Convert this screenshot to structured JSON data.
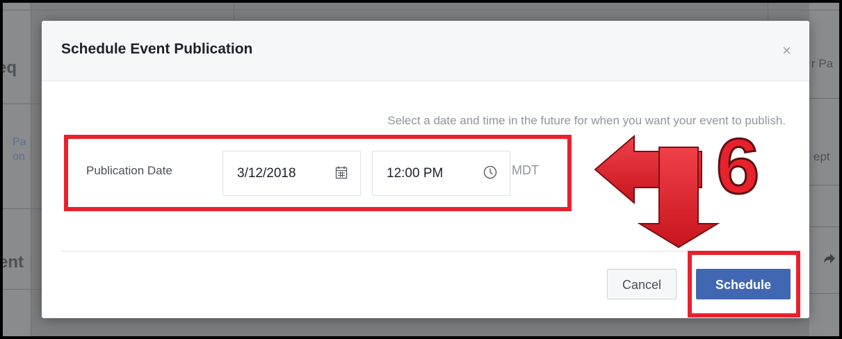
{
  "background": {
    "fragments": [
      "eq",
      "r Pa",
      "Pa",
      "on",
      "ept",
      "ent"
    ]
  },
  "dialog": {
    "title": "Schedule Event Publication",
    "close_glyph": "×",
    "hint": "Select a date and time in the future for when you want your event to publish.",
    "publication_label": "Publication Date",
    "date_value": "3/12/2018",
    "time_value": "12:00 PM",
    "timezone": "MDT",
    "cancel_label": "Cancel",
    "schedule_label": "Schedule"
  },
  "annotation": {
    "step_number": "6"
  },
  "icons": {
    "date": "calendar-icon",
    "time": "clock-icon",
    "close": "close-icon"
  },
  "colors": {
    "annotation_red": "#e8212d",
    "primary_button": "#4267b2",
    "overlay": "#7d7e80"
  }
}
